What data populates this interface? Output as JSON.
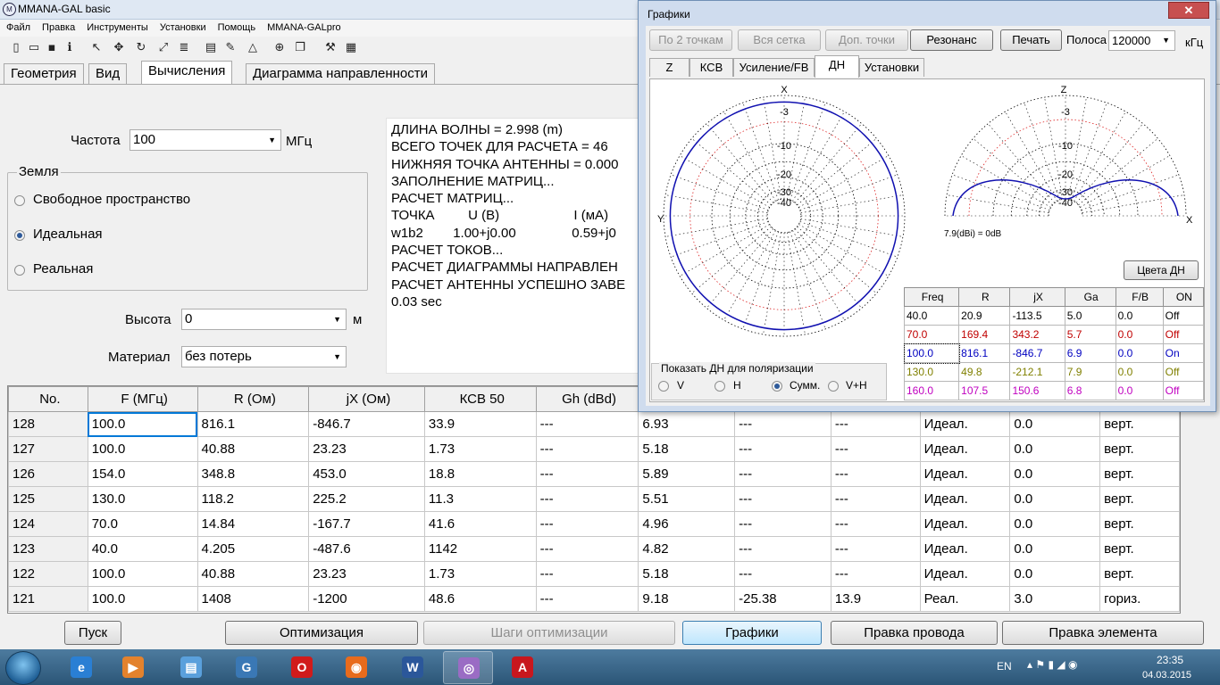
{
  "app": {
    "title": "MMANA-GAL basic",
    "menu": [
      "Файл",
      "Правка",
      "Инструменты",
      "Установки",
      "Помощь",
      "MMANA-GALpro"
    ],
    "tabs": [
      "Геометрия",
      "Вид",
      "Вычисления",
      "Диаграмма направленности"
    ],
    "active_tab": 2
  },
  "calc": {
    "freq_label": "Частота",
    "freq_value": "100",
    "freq_unit": "МГц",
    "ground_title": "Земля",
    "ground_options": [
      "Свободное пространство",
      "Идеальная",
      "Реальная"
    ],
    "ground_selected": 1,
    "height_label": "Высота",
    "height_value": "0",
    "height_unit": "м",
    "material_label": "Материал",
    "material_value": "без потерь"
  },
  "log": [
    "ДЛИНА ВОЛНЫ = 2.998 (m)",
    "ВСЕГО ТОЧЕК ДЛЯ РАСЧЕТА = 46",
    "НИЖНЯЯ ТОЧКА АНТЕННЫ = 0.000",
    "ЗАПОЛНЕНИЕ МАТРИЦ...",
    "РАСЧЕТ МАТРИЦ...",
    "ТОЧКА         U (В)                    I (мА)",
    "w1b2        1.00+j0.00               0.59+j0",
    "РАСЧЕТ ТОКОВ...",
    "РАСЧЕТ ДИАГРАММЫ НАПРАВЛЕН",
    "РАСЧЕТ АНТЕННЫ УСПЕШНО ЗАВЕ",
    "0.03 sec"
  ],
  "results": {
    "headers": [
      "No.",
      "F (МГц)",
      "R (Ом)",
      "jX (Ом)",
      "КСВ 50",
      "Gh (dBd)",
      "",
      "",
      "",
      "",
      "",
      ""
    ],
    "rows": [
      [
        "128",
        "100.0",
        "816.1",
        "-846.7",
        "33.9",
        "---",
        "6.93",
        "---",
        "---",
        "Идеал.",
        "0.0",
        "верт."
      ],
      [
        "127",
        "100.0",
        "40.88",
        "23.23",
        "1.73",
        "---",
        "5.18",
        "---",
        "---",
        "Идеал.",
        "0.0",
        "верт."
      ],
      [
        "126",
        "154.0",
        "348.8",
        "453.0",
        "18.8",
        "---",
        "5.89",
        "---",
        "---",
        "Идеал.",
        "0.0",
        "верт."
      ],
      [
        "125",
        "130.0",
        "118.2",
        "225.2",
        "11.3",
        "---",
        "5.51",
        "---",
        "---",
        "Идеал.",
        "0.0",
        "верт."
      ],
      [
        "124",
        "70.0",
        "14.84",
        "-167.7",
        "41.6",
        "---",
        "4.96",
        "---",
        "---",
        "Идеал.",
        "0.0",
        "верт."
      ],
      [
        "123",
        "40.0",
        "4.205",
        "-487.6",
        "1142",
        "---",
        "4.82",
        "---",
        "---",
        "Идеал.",
        "0.0",
        "верт."
      ],
      [
        "122",
        "100.0",
        "40.88",
        "23.23",
        "1.73",
        "---",
        "5.18",
        "---",
        "---",
        "Идеал.",
        "0.0",
        "верт."
      ],
      [
        "121",
        "100.0",
        "1408",
        "-1200",
        "48.6",
        "---",
        "9.18",
        "-25.38",
        "13.9",
        "Реал.",
        "3.0",
        "гориз."
      ]
    ]
  },
  "buttons": {
    "start": "Пуск",
    "optimize": "Оптимизация",
    "opt_steps": "Шаги оптимизации",
    "graphs": "Графики",
    "edit_wire": "Правка провода",
    "edit_element": "Правка элемента"
  },
  "graphs": {
    "title": "Графики",
    "close": "✕",
    "buttons": [
      "По 2 точкам",
      "Вся сетка",
      "Доп. точки",
      "Резонанс",
      "Печать"
    ],
    "band_label": "Полоса",
    "band_value": "120000",
    "band_unit": "кГц",
    "tabs": [
      "Z",
      "КСВ",
      "Усиление/FB",
      "ДН",
      "Установки"
    ],
    "active_tab": 3,
    "plot": {
      "az_top_label": "X",
      "az_left_label": "Y",
      "el_top_label": "Z",
      "el_right_label": "X",
      "ring_labels": [
        "-3",
        "-10",
        "-20",
        "-30",
        "-40"
      ],
      "gain_note": "7.9(dBi) = 0dB",
      "colors_button": "Цвета ДН"
    },
    "freq_table": {
      "headers": [
        "Freq",
        "R",
        "jX",
        "Ga",
        "F/B",
        "ON"
      ],
      "rows": [
        {
          "cells": [
            "40.0",
            "20.9",
            "-113.5",
            "5.0",
            "0.0",
            "Off"
          ],
          "color": "#000000"
        },
        {
          "cells": [
            "70.0",
            "169.4",
            "343.2",
            "5.7",
            "0.0",
            "Off"
          ],
          "color": "#c00000"
        },
        {
          "cells": [
            "100.0",
            "816.1",
            "-846.7",
            "6.9",
            "0.0",
            "On"
          ],
          "color": "#0000c0"
        },
        {
          "cells": [
            "130.0",
            "49.8",
            "-212.1",
            "7.9",
            "0.0",
            "Off"
          ],
          "color": "#808000"
        },
        {
          "cells": [
            "160.0",
            "107.5",
            "150.6",
            "6.8",
            "0.0",
            "Off"
          ],
          "color": "#c000c0"
        }
      ]
    },
    "polarization": {
      "title": "Показать ДН для поляризации",
      "options": [
        "V",
        "H",
        "Сумм.",
        "V+H"
      ],
      "selected": 2
    }
  },
  "taskbar": {
    "lang": "EN",
    "time": "23:35",
    "date": "04.03.2015",
    "apps": [
      {
        "name": "ie",
        "glyph": "e",
        "color": "#2a7fd4"
      },
      {
        "name": "media",
        "glyph": "▶",
        "color": "#e3822d"
      },
      {
        "name": "files",
        "glyph": "▤",
        "color": "#5aa0dc"
      },
      {
        "name": "chrome-like",
        "glyph": "G",
        "color": "#3a78b5"
      },
      {
        "name": "opera",
        "glyph": "O",
        "color": "#d11b1b"
      },
      {
        "name": "firefox",
        "glyph": "◉",
        "color": "#e86b1c"
      },
      {
        "name": "word",
        "glyph": "W",
        "color": "#2b579a"
      },
      {
        "name": "mmana",
        "glyph": "◎",
        "color": "#9a6cc4"
      },
      {
        "name": "pdf",
        "glyph": "A",
        "color": "#c8171e"
      }
    ]
  }
}
